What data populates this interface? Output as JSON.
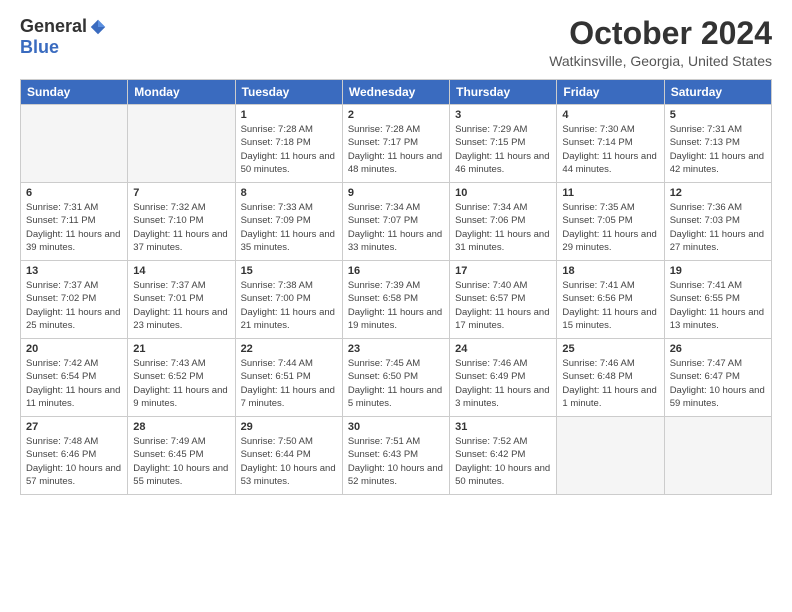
{
  "logo": {
    "general": "General",
    "blue": "Blue"
  },
  "header": {
    "month": "October 2024",
    "location": "Watkinsville, Georgia, United States"
  },
  "days_of_week": [
    "Sunday",
    "Monday",
    "Tuesday",
    "Wednesday",
    "Thursday",
    "Friday",
    "Saturday"
  ],
  "weeks": [
    [
      {
        "day": "",
        "empty": true
      },
      {
        "day": "",
        "empty": true
      },
      {
        "day": "1",
        "sunrise": "7:28 AM",
        "sunset": "7:18 PM",
        "daylight": "11 hours and 50 minutes."
      },
      {
        "day": "2",
        "sunrise": "7:28 AM",
        "sunset": "7:17 PM",
        "daylight": "11 hours and 48 minutes."
      },
      {
        "day": "3",
        "sunrise": "7:29 AM",
        "sunset": "7:15 PM",
        "daylight": "11 hours and 46 minutes."
      },
      {
        "day": "4",
        "sunrise": "7:30 AM",
        "sunset": "7:14 PM",
        "daylight": "11 hours and 44 minutes."
      },
      {
        "day": "5",
        "sunrise": "7:31 AM",
        "sunset": "7:13 PM",
        "daylight": "11 hours and 42 minutes."
      }
    ],
    [
      {
        "day": "6",
        "sunrise": "7:31 AM",
        "sunset": "7:11 PM",
        "daylight": "11 hours and 39 minutes."
      },
      {
        "day": "7",
        "sunrise": "7:32 AM",
        "sunset": "7:10 PM",
        "daylight": "11 hours and 37 minutes."
      },
      {
        "day": "8",
        "sunrise": "7:33 AM",
        "sunset": "7:09 PM",
        "daylight": "11 hours and 35 minutes."
      },
      {
        "day": "9",
        "sunrise": "7:34 AM",
        "sunset": "7:07 PM",
        "daylight": "11 hours and 33 minutes."
      },
      {
        "day": "10",
        "sunrise": "7:34 AM",
        "sunset": "7:06 PM",
        "daylight": "11 hours and 31 minutes."
      },
      {
        "day": "11",
        "sunrise": "7:35 AM",
        "sunset": "7:05 PM",
        "daylight": "11 hours and 29 minutes."
      },
      {
        "day": "12",
        "sunrise": "7:36 AM",
        "sunset": "7:03 PM",
        "daylight": "11 hours and 27 minutes."
      }
    ],
    [
      {
        "day": "13",
        "sunrise": "7:37 AM",
        "sunset": "7:02 PM",
        "daylight": "11 hours and 25 minutes."
      },
      {
        "day": "14",
        "sunrise": "7:37 AM",
        "sunset": "7:01 PM",
        "daylight": "11 hours and 23 minutes."
      },
      {
        "day": "15",
        "sunrise": "7:38 AM",
        "sunset": "7:00 PM",
        "daylight": "11 hours and 21 minutes."
      },
      {
        "day": "16",
        "sunrise": "7:39 AM",
        "sunset": "6:58 PM",
        "daylight": "11 hours and 19 minutes."
      },
      {
        "day": "17",
        "sunrise": "7:40 AM",
        "sunset": "6:57 PM",
        "daylight": "11 hours and 17 minutes."
      },
      {
        "day": "18",
        "sunrise": "7:41 AM",
        "sunset": "6:56 PM",
        "daylight": "11 hours and 15 minutes."
      },
      {
        "day": "19",
        "sunrise": "7:41 AM",
        "sunset": "6:55 PM",
        "daylight": "11 hours and 13 minutes."
      }
    ],
    [
      {
        "day": "20",
        "sunrise": "7:42 AM",
        "sunset": "6:54 PM",
        "daylight": "11 hours and 11 minutes."
      },
      {
        "day": "21",
        "sunrise": "7:43 AM",
        "sunset": "6:52 PM",
        "daylight": "11 hours and 9 minutes."
      },
      {
        "day": "22",
        "sunrise": "7:44 AM",
        "sunset": "6:51 PM",
        "daylight": "11 hours and 7 minutes."
      },
      {
        "day": "23",
        "sunrise": "7:45 AM",
        "sunset": "6:50 PM",
        "daylight": "11 hours and 5 minutes."
      },
      {
        "day": "24",
        "sunrise": "7:46 AM",
        "sunset": "6:49 PM",
        "daylight": "11 hours and 3 minutes."
      },
      {
        "day": "25",
        "sunrise": "7:46 AM",
        "sunset": "6:48 PM",
        "daylight": "11 hours and 1 minute."
      },
      {
        "day": "26",
        "sunrise": "7:47 AM",
        "sunset": "6:47 PM",
        "daylight": "10 hours and 59 minutes."
      }
    ],
    [
      {
        "day": "27",
        "sunrise": "7:48 AM",
        "sunset": "6:46 PM",
        "daylight": "10 hours and 57 minutes."
      },
      {
        "day": "28",
        "sunrise": "7:49 AM",
        "sunset": "6:45 PM",
        "daylight": "10 hours and 55 minutes."
      },
      {
        "day": "29",
        "sunrise": "7:50 AM",
        "sunset": "6:44 PM",
        "daylight": "10 hours and 53 minutes."
      },
      {
        "day": "30",
        "sunrise": "7:51 AM",
        "sunset": "6:43 PM",
        "daylight": "10 hours and 52 minutes."
      },
      {
        "day": "31",
        "sunrise": "7:52 AM",
        "sunset": "6:42 PM",
        "daylight": "10 hours and 50 minutes."
      },
      {
        "day": "",
        "empty": true
      },
      {
        "day": "",
        "empty": true
      }
    ]
  ]
}
